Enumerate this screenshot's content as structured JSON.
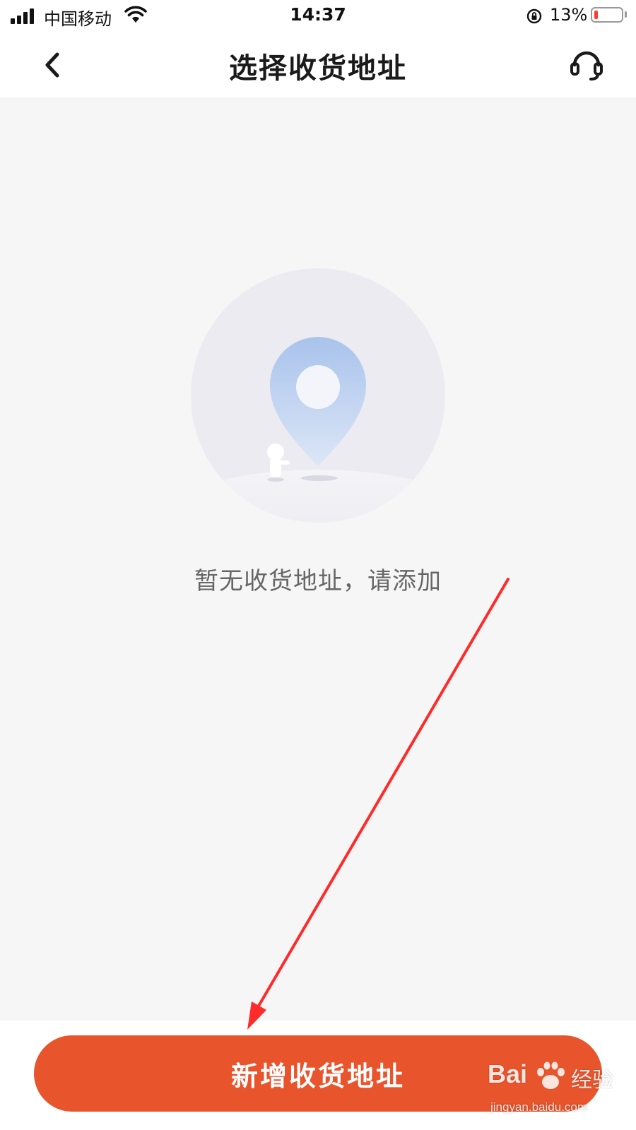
{
  "status_bar": {
    "carrier": "中国移动",
    "time": "14:37",
    "battery_percent": "13%",
    "battery_level": 0.13,
    "icons": [
      "signal-icon",
      "wifi-icon",
      "orientation-lock-icon",
      "battery-icon"
    ]
  },
  "nav": {
    "title": "选择收货地址",
    "back_icon": "chevron-left-icon",
    "service_icon": "headset-icon"
  },
  "empty_state": {
    "illustration": "location-pin-illustration",
    "message": "暂无收货地址，请添加"
  },
  "bottom": {
    "add_button_label": "新增收货地址"
  },
  "watermark": {
    "brand": "Bai",
    "brand_cn": "经验",
    "url": "jingyan.baidu.com"
  },
  "colors": {
    "accent": "#e8542b",
    "background": "#f6f6f6",
    "annotation": "#ff2a2a"
  }
}
